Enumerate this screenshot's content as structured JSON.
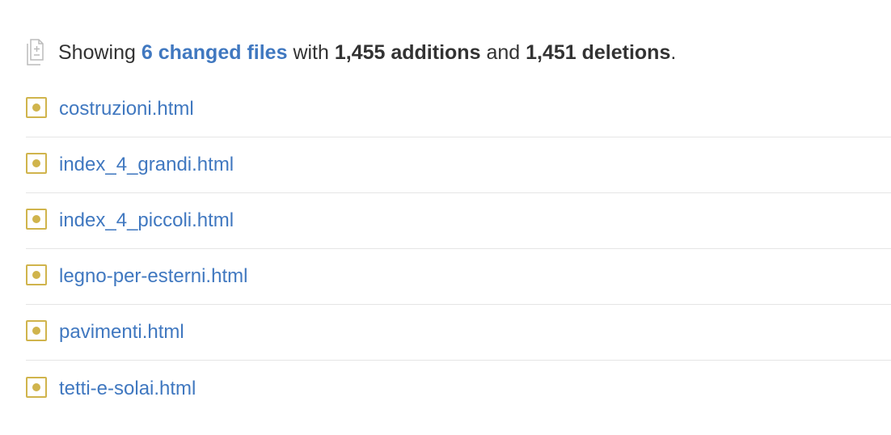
{
  "summary": {
    "prefix": "Showing",
    "changed_files_link": "6 changed files",
    "with": "with",
    "additions": "1,455 additions",
    "and": "and",
    "deletions": "1,451 deletions",
    "suffix": "."
  },
  "icons": {
    "summary_icon": "file-diff-icon",
    "file_status_icon": "modified-icon"
  },
  "colors": {
    "link": "#4078c0",
    "modified": "#d0b44c",
    "text": "#333333",
    "divider": "#e5e5e5"
  },
  "files": [
    {
      "name": "costruzioni.html",
      "status": "modified"
    },
    {
      "name": "index_4_grandi.html",
      "status": "modified"
    },
    {
      "name": "index_4_piccoli.html",
      "status": "modified"
    },
    {
      "name": "legno-per-esterni.html",
      "status": "modified"
    },
    {
      "name": "pavimenti.html",
      "status": "modified"
    },
    {
      "name": "tetti-e-solai.html",
      "status": "modified"
    }
  ]
}
